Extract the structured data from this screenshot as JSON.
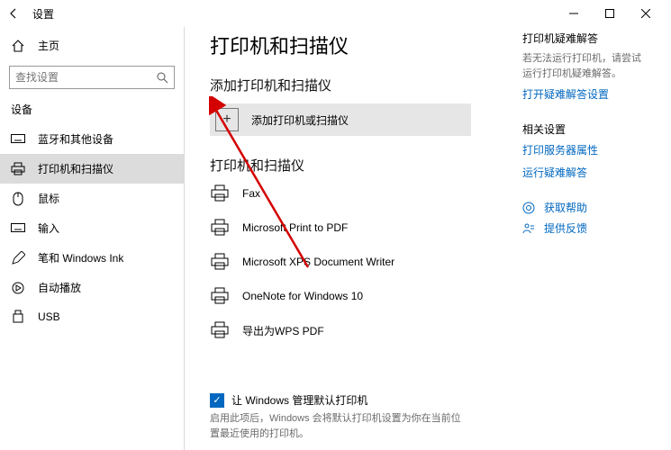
{
  "titlebar": {
    "title": "设置"
  },
  "sidebar": {
    "home": "主页",
    "search_placeholder": "查找设置",
    "section": "设备",
    "items": [
      {
        "label": "蓝牙和其他设备"
      },
      {
        "label": "打印机和扫描仪"
      },
      {
        "label": "鼠标"
      },
      {
        "label": "输入"
      },
      {
        "label": "笔和 Windows Ink"
      },
      {
        "label": "自动播放"
      },
      {
        "label": "USB"
      }
    ]
  },
  "main": {
    "heading": "打印机和扫描仪",
    "add_section": "添加打印机和扫描仪",
    "add_label": "添加打印机或扫描仪",
    "list_section": "打印机和扫描仪",
    "printers": [
      {
        "label": "Fax"
      },
      {
        "label": "Microsoft Print to PDF"
      },
      {
        "label": "Microsoft XPS Document Writer"
      },
      {
        "label": "OneNote for Windows 10"
      },
      {
        "label": "导出为WPS PDF"
      }
    ],
    "default_chk": "让 Windows 管理默认打印机",
    "default_desc": "启用此项后，Windows 会将默认打印机设置为你在当前位置最近使用的打印机。"
  },
  "right": {
    "trouble_head": "打印机疑难解答",
    "trouble_desc": "若无法运行打印机，请尝试运行打印机疑难解答。",
    "trouble_link": "打开疑难解答设置",
    "related_head": "相关设置",
    "related_link1": "打印服务器属性",
    "related_link2": "运行疑难解答",
    "help": "获取帮助",
    "feedback": "提供反馈"
  }
}
